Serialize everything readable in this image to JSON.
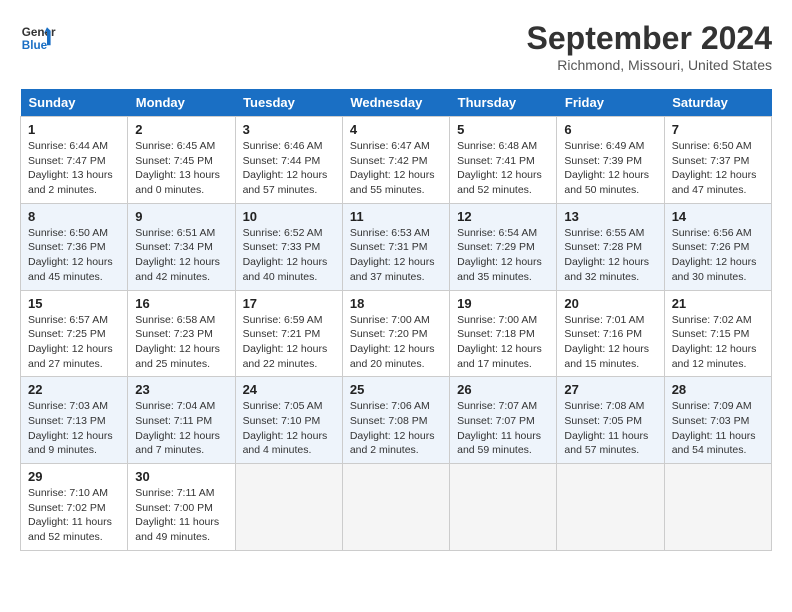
{
  "header": {
    "logo_line1": "General",
    "logo_line2": "Blue",
    "month": "September 2024",
    "location": "Richmond, Missouri, United States"
  },
  "days_of_week": [
    "Sunday",
    "Monday",
    "Tuesday",
    "Wednesday",
    "Thursday",
    "Friday",
    "Saturday"
  ],
  "weeks": [
    [
      {
        "day": 1,
        "sunrise": "6:44 AM",
        "sunset": "7:47 PM",
        "daylight": "13 hours and 2 minutes."
      },
      {
        "day": 2,
        "sunrise": "6:45 AM",
        "sunset": "7:45 PM",
        "daylight": "13 hours and 0 minutes."
      },
      {
        "day": 3,
        "sunrise": "6:46 AM",
        "sunset": "7:44 PM",
        "daylight": "12 hours and 57 minutes."
      },
      {
        "day": 4,
        "sunrise": "6:47 AM",
        "sunset": "7:42 PM",
        "daylight": "12 hours and 55 minutes."
      },
      {
        "day": 5,
        "sunrise": "6:48 AM",
        "sunset": "7:41 PM",
        "daylight": "12 hours and 52 minutes."
      },
      {
        "day": 6,
        "sunrise": "6:49 AM",
        "sunset": "7:39 PM",
        "daylight": "12 hours and 50 minutes."
      },
      {
        "day": 7,
        "sunrise": "6:50 AM",
        "sunset": "7:37 PM",
        "daylight": "12 hours and 47 minutes."
      }
    ],
    [
      {
        "day": 8,
        "sunrise": "6:50 AM",
        "sunset": "7:36 PM",
        "daylight": "12 hours and 45 minutes."
      },
      {
        "day": 9,
        "sunrise": "6:51 AM",
        "sunset": "7:34 PM",
        "daylight": "12 hours and 42 minutes."
      },
      {
        "day": 10,
        "sunrise": "6:52 AM",
        "sunset": "7:33 PM",
        "daylight": "12 hours and 40 minutes."
      },
      {
        "day": 11,
        "sunrise": "6:53 AM",
        "sunset": "7:31 PM",
        "daylight": "12 hours and 37 minutes."
      },
      {
        "day": 12,
        "sunrise": "6:54 AM",
        "sunset": "7:29 PM",
        "daylight": "12 hours and 35 minutes."
      },
      {
        "day": 13,
        "sunrise": "6:55 AM",
        "sunset": "7:28 PM",
        "daylight": "12 hours and 32 minutes."
      },
      {
        "day": 14,
        "sunrise": "6:56 AM",
        "sunset": "7:26 PM",
        "daylight": "12 hours and 30 minutes."
      }
    ],
    [
      {
        "day": 15,
        "sunrise": "6:57 AM",
        "sunset": "7:25 PM",
        "daylight": "12 hours and 27 minutes."
      },
      {
        "day": 16,
        "sunrise": "6:58 AM",
        "sunset": "7:23 PM",
        "daylight": "12 hours and 25 minutes."
      },
      {
        "day": 17,
        "sunrise": "6:59 AM",
        "sunset": "7:21 PM",
        "daylight": "12 hours and 22 minutes."
      },
      {
        "day": 18,
        "sunrise": "7:00 AM",
        "sunset": "7:20 PM",
        "daylight": "12 hours and 20 minutes."
      },
      {
        "day": 19,
        "sunrise": "7:00 AM",
        "sunset": "7:18 PM",
        "daylight": "12 hours and 17 minutes."
      },
      {
        "day": 20,
        "sunrise": "7:01 AM",
        "sunset": "7:16 PM",
        "daylight": "12 hours and 15 minutes."
      },
      {
        "day": 21,
        "sunrise": "7:02 AM",
        "sunset": "7:15 PM",
        "daylight": "12 hours and 12 minutes."
      }
    ],
    [
      {
        "day": 22,
        "sunrise": "7:03 AM",
        "sunset": "7:13 PM",
        "daylight": "12 hours and 9 minutes."
      },
      {
        "day": 23,
        "sunrise": "7:04 AM",
        "sunset": "7:11 PM",
        "daylight": "12 hours and 7 minutes."
      },
      {
        "day": 24,
        "sunrise": "7:05 AM",
        "sunset": "7:10 PM",
        "daylight": "12 hours and 4 minutes."
      },
      {
        "day": 25,
        "sunrise": "7:06 AM",
        "sunset": "7:08 PM",
        "daylight": "12 hours and 2 minutes."
      },
      {
        "day": 26,
        "sunrise": "7:07 AM",
        "sunset": "7:07 PM",
        "daylight": "11 hours and 59 minutes."
      },
      {
        "day": 27,
        "sunrise": "7:08 AM",
        "sunset": "7:05 PM",
        "daylight": "11 hours and 57 minutes."
      },
      {
        "day": 28,
        "sunrise": "7:09 AM",
        "sunset": "7:03 PM",
        "daylight": "11 hours and 54 minutes."
      }
    ],
    [
      {
        "day": 29,
        "sunrise": "7:10 AM",
        "sunset": "7:02 PM",
        "daylight": "11 hours and 52 minutes."
      },
      {
        "day": 30,
        "sunrise": "7:11 AM",
        "sunset": "7:00 PM",
        "daylight": "11 hours and 49 minutes."
      },
      null,
      null,
      null,
      null,
      null
    ]
  ]
}
